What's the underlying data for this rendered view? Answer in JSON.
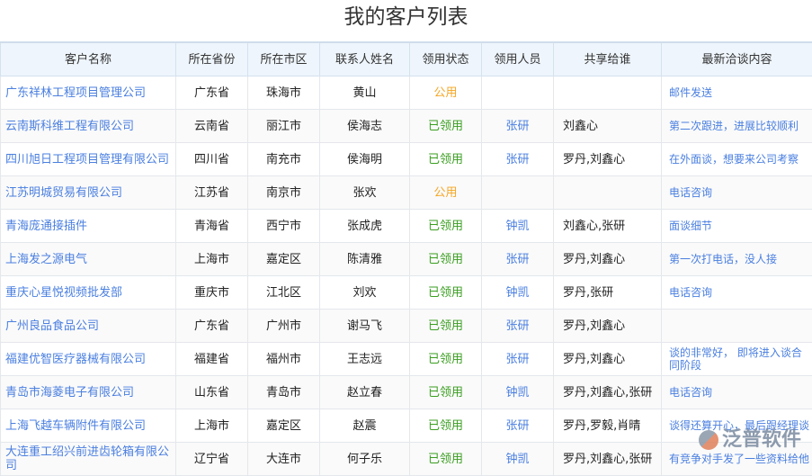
{
  "title": "我的客户列表",
  "columns": [
    "客户名称",
    "所在省份",
    "所在市区",
    "联系人姓名",
    "领用状态",
    "领用人员",
    "共享给谁",
    "最新洽谈内容"
  ],
  "colors": {
    "link": "#4a7fe0",
    "public": "#f5a623",
    "claimed": "#3a9e20"
  },
  "rows": [
    [
      "广东祥林工程项目管理公司",
      "广东省",
      "珠海市",
      "黄山",
      "公用",
      "",
      "",
      "邮件发送"
    ],
    [
      "云南斯科维工程有限公司",
      "云南省",
      "丽江市",
      "侯海志",
      "已领用",
      "张研",
      "刘鑫心",
      "第二次跟进，进展比较顺利"
    ],
    [
      "四川旭日工程项目管理有限公司",
      "四川省",
      "南充市",
      "侯海明",
      "已领用",
      "张研",
      "罗丹,刘鑫心",
      "在外面谈，想要来公司考察"
    ],
    [
      "江苏明城贸易有限公司",
      "江苏省",
      "南京市",
      "张欢",
      "公用",
      "",
      "",
      "电话咨询"
    ],
    [
      "青海庞通接插件",
      "青海省",
      "西宁市",
      "张成虎",
      "已领用",
      "钟凯",
      "刘鑫心,张研",
      "面谈细节"
    ],
    [
      "上海发之源电气",
      "上海市",
      "嘉定区",
      "陈清雅",
      "已领用",
      "张研",
      "罗丹,刘鑫心",
      "第一次打电话，没人接"
    ],
    [
      "重庆心星悦视频批发部",
      "重庆市",
      "江北区",
      "刘欢",
      "已领用",
      "钟凯",
      "罗丹,张研",
      "电话咨询"
    ],
    [
      "广州良品食品公司",
      "广东省",
      "广州市",
      "谢马飞",
      "已领用",
      "张研",
      "罗丹,刘鑫心",
      ""
    ],
    [
      "福建优智医疗器械有限公司",
      "福建省",
      "福州市",
      "王志远",
      "已领用",
      "张研",
      "罗丹,刘鑫心",
      "谈的非常好， 即将进入谈合同阶段"
    ],
    [
      "青岛市海菱电子有限公司",
      "山东省",
      "青岛市",
      "赵立春",
      "已领用",
      "钟凯",
      "罗丹,刘鑫心,张研",
      "电话咨询"
    ],
    [
      "上海飞越车辆附件有限公司",
      "上海市",
      "嘉定区",
      "赵震",
      "已领用",
      "张研",
      "罗丹,罗毅,肖晴",
      "谈得还算开心，最后跟经理谈"
    ],
    [
      "大连重工绍兴前进齿轮箱有限公司",
      "辽宁省",
      "大连市",
      "何子乐",
      "已领用",
      "钟凯",
      "罗丹,刘鑫心,张研",
      "有竞争对手发了一些资料给他"
    ]
  ],
  "watermark": "泛普软件"
}
